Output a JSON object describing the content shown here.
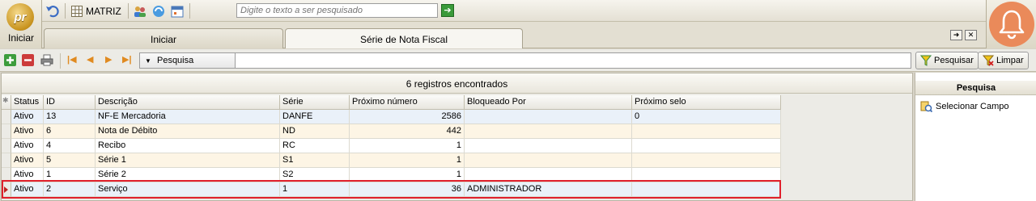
{
  "app": {
    "start_label": "Iniciar",
    "logo_text": "pr"
  },
  "toolbar": {
    "company_label": "MATRIZ",
    "search_placeholder": "Digite o texto a ser pesquisado"
  },
  "tabs": [
    {
      "label": "Iniciar",
      "active": false
    },
    {
      "label": "Série de Nota Fiscal",
      "active": true
    }
  ],
  "filter_bar": {
    "field_select_label": "Pesquisa",
    "search_button": "Pesquisar",
    "clear_button": "Limpar"
  },
  "grid": {
    "caption": "6 registros encontrados",
    "columns": [
      "Status",
      "ID",
      "Descrição",
      "Série",
      "Próximo número",
      "Bloqueado Por",
      "Próximo selo"
    ],
    "rows": [
      {
        "status": "Ativo",
        "id": "13",
        "descricao": "NF-E Mercadoria",
        "serie": "DANFE",
        "proximo_numero": "2586",
        "bloqueado_por": "",
        "proximo_selo": "0"
      },
      {
        "status": "Ativo",
        "id": "6",
        "descricao": "Nota de Débito",
        "serie": "ND",
        "proximo_numero": "442",
        "bloqueado_por": "",
        "proximo_selo": ""
      },
      {
        "status": "Ativo",
        "id": "4",
        "descricao": "Recibo",
        "serie": "RC",
        "proximo_numero": "1",
        "bloqueado_por": "",
        "proximo_selo": ""
      },
      {
        "status": "Ativo",
        "id": "5",
        "descricao": "Série 1",
        "serie": "S1",
        "proximo_numero": "1",
        "bloqueado_por": "",
        "proximo_selo": ""
      },
      {
        "status": "Ativo",
        "id": "1",
        "descricao": "Série 2",
        "serie": "S2",
        "proximo_numero": "1",
        "bloqueado_por": "",
        "proximo_selo": ""
      },
      {
        "status": "Ativo",
        "id": "2",
        "descricao": "Serviço",
        "serie": "1",
        "proximo_numero": "36",
        "bloqueado_por": "ADMINISTRADOR",
        "proximo_selo": ""
      }
    ],
    "selected_row": 5
  },
  "side_panel": {
    "title": "Pesquisa",
    "item_label": "Selecionar Campo"
  },
  "colors": {
    "selection_outline": "#e0202c",
    "notification_badge": "#ea8a5a",
    "logo_gold": "#c8931e"
  }
}
